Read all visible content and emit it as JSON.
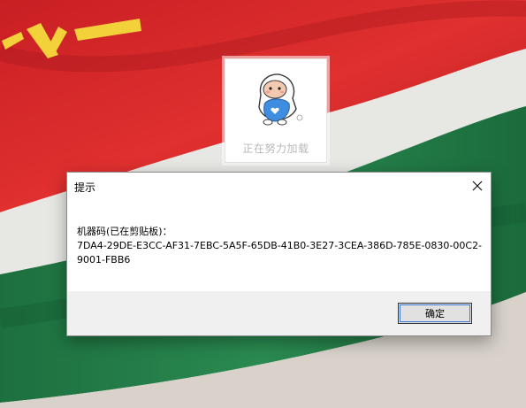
{
  "loader": {
    "text": "正在努力加载",
    "icon": "mascot-icon"
  },
  "dialog": {
    "title": "提示",
    "close_icon": "close-icon",
    "message_label": "机器码(已在剪贴板)：",
    "machine_code_line1": "7DA4-29DE-E3CC-AF31-7EBC-5A5F-65DB-41B0-3E27-3CEA-386D-785E-0830-00C2-",
    "machine_code_line2": "9001-FBB6",
    "ok_label": "确定"
  },
  "colors": {
    "flag_red": "#d9242a",
    "flag_green": "#1f7a45",
    "flag_star_yellow": "#f2d13a",
    "dialog_footer": "#f0f0f0",
    "button_bg": "#e1e1e1",
    "focus_blue": "#3a7bd5"
  }
}
